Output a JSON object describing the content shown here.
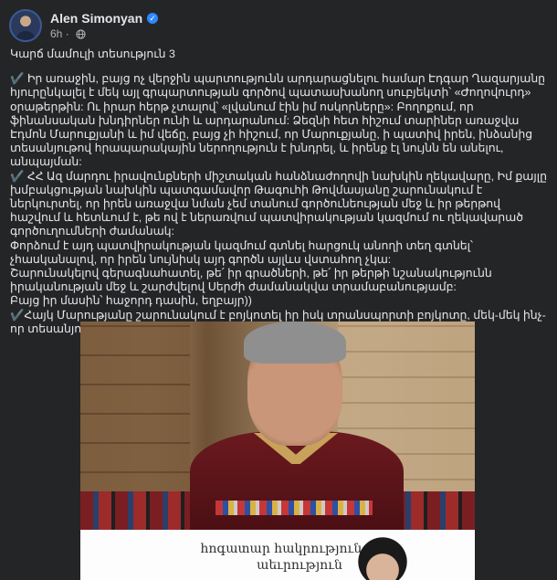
{
  "post": {
    "author": "Alen Simonyan",
    "verified_icon": "verified-badge-icon",
    "time": "6h",
    "audience_icon": "globe-icon",
    "title_line": "Կարճ մամուլի տեսություն 3",
    "paragraphs": [
      "✔️ Իր առաջին, բայց ոչ վերջին պարտությունն արդարացնելու համար Էդգար Ղազարյանը հյուրընկալել է մեկ այլ գրպարտության գործով պատասխանող սուբյեկտի՝ «Ժողովուրդ» օրաթերթին: Ու իրար հերթ չտալով՝ «լվանում էին իմ ոսկորները»: Բողոքում, որ ֆինանսական խնդիրներ ունի և արդարանում: Ձեզնի հետ հիշում տարիներ առաջվա Էդմոն Մարուքյանի և իմ վեճը, բայց չի հիշում, որ Մարուքյանը, ի պատիվ իրեն, ինձանից տեսանյութով հրապարակային ներողություն է խնդրել, և իրենք էլ նույնն են անելու, անպայման:",
      "✔️ ՀՀ Ազ մարդու իրավունքների միշտական հանձնաժողովի նախկին ղեկավարը, Իմ քայլը խմբակցության նախկին պատգամավոր Թագուհի Թովմասյանը շարունակում է ներկուրտել, որ իրեն առաջվա նման չեմ տանում գործունեության մեջ և իր թերթով հաշվում և հետևում է, թե ով է ներառվում պատվիրակության կազմում ու ղեկավարած գործուղումների ժամանակ:",
      "Փորձում է այդ պատվիրակության կազմում գտնել հարցուկ անողի տեղ գտնել՝ չհասկանալով, որ իրեն նույնիսկ այդ գործն այլևս վստահող չկա:",
      "Շարունակելով գերագնահատել, թե՛ իր գրածների, թե՛ իր թերթի նշանակությունն իրականության մեջ և շարժվելով Սերժի ժամանակվա տրամաբանությամբ:",
      "Բայց իր մասին՝ հաջորդ դասին, եղբայր))",
      "✔️Հայկ Մարությանը շարունակում է բոյկոտել իր իսկ տրանսպորտի բոյկոտը, մեկ-մեկ ինչ-որ տեսանյութ հրապարակել, դե դրսում ցուրտ է, ո՞վ հավես ունի:"
    ],
    "poster_text": "հոգատար հակրություն, հ...ր աեւրություն"
  }
}
